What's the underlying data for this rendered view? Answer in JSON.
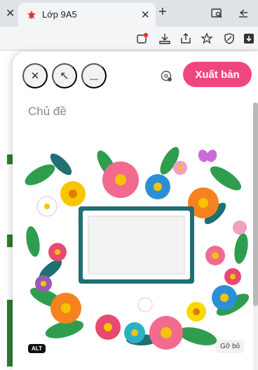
{
  "browser": {
    "tab_title": "Lớp 9A5",
    "tab_close_left_glyph": "✕",
    "tab_close_glyph": "✕",
    "new_tab_glyph": "+"
  },
  "modal": {
    "close_glyph": "✕",
    "expand_glyph": "↖",
    "minimize_glyph": "—",
    "publish_label": "Xuất bản",
    "topic_placeholder": "Chủ đề",
    "alt_badge": "ALT",
    "remove_label": "Gỡ bỏ"
  },
  "colors": {
    "publish_button": "#f0467e",
    "page_accent_green": "#2e7d32"
  },
  "icons": [
    "tab-favicon",
    "reader-view-icon",
    "back-arrows-icon",
    "sync-icon",
    "download-icon",
    "share-icon",
    "star-icon",
    "shield-icon",
    "download-arrow-icon",
    "settings-icon"
  ]
}
